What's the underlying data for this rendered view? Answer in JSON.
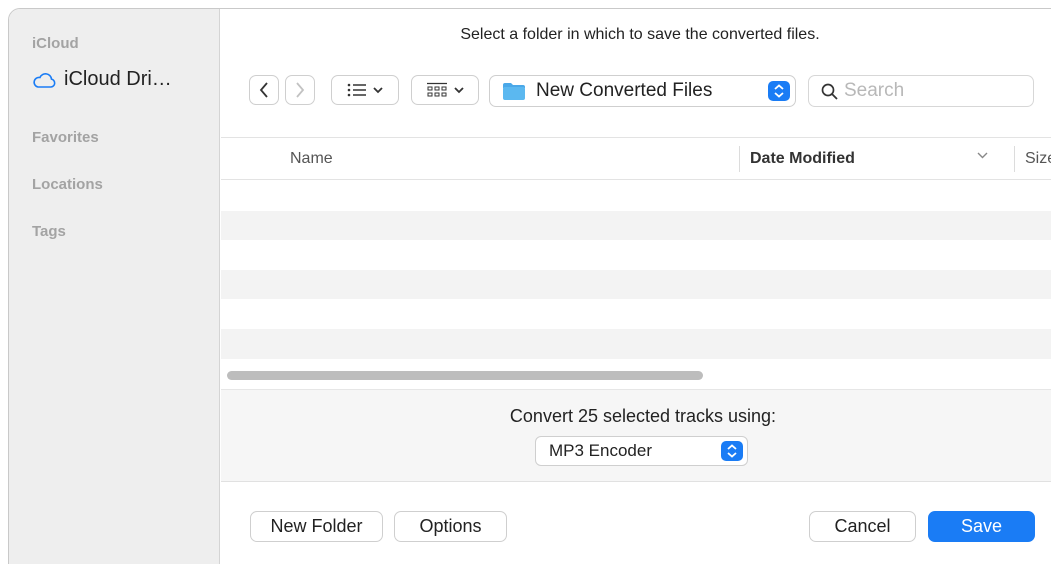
{
  "sidebar": {
    "sections": {
      "icloud": "iCloud",
      "favorites": "Favorites",
      "locations": "Locations",
      "tags": "Tags"
    },
    "items": [
      {
        "label": "iCloud Dri…",
        "icon": "cloud-icon"
      }
    ]
  },
  "dialog": {
    "instruction": "Select a folder in which to save the converted files."
  },
  "toolbar": {
    "folder_name": "New Converted Files",
    "search_placeholder": "Search"
  },
  "file_list": {
    "columns": [
      "Name",
      "Date Modified",
      "Size"
    ],
    "sorted_by": "Date Modified",
    "rows": []
  },
  "conversion": {
    "label": "Convert 25 selected tracks using:",
    "encoder": "MP3 Encoder"
  },
  "buttons": {
    "new_folder": "New Folder",
    "options": "Options",
    "cancel": "Cancel",
    "save": "Save"
  },
  "colors": {
    "accent": "#1a7cf5",
    "sidebar_bg": "#eeeeee"
  }
}
